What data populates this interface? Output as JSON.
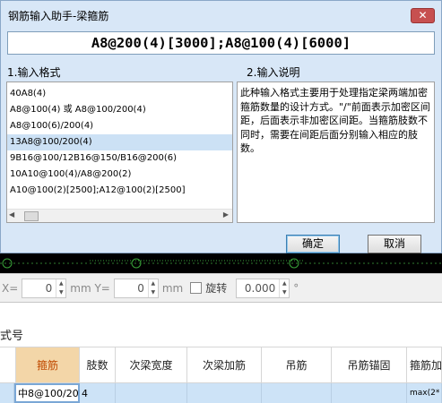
{
  "dialog": {
    "title": "钢筋输入助手-梁箍筋",
    "close_glyph": "✕",
    "input_value": "A8@200(4)[3000];A8@100(4)[6000]",
    "format_label": "1.输入格式",
    "desc_label": "2.输入说明",
    "formats": [
      "40A8(4)",
      "A8@100(4) 或 A8@100/200(4)",
      "A8@100(6)/200(4)",
      "13A8@100/200(4)",
      "9B16@100/12B16@150/B16@200(6)",
      "10A10@100(4)/A8@200(2)",
      "A10@100(2)[2500];A12@100(2)[2500]"
    ],
    "description": "此种输入格式主要用于处理指定梁两端加密箍筋数量的设计方式。\"/\"前面表示加密区间距，后面表示非加密区间距。当箍筋肢数不同时，需要在间距后面分别输入相应的肢数。",
    "ok_label": "确定",
    "cancel_label": "取消"
  },
  "statusbar": {
    "x_label": "X=",
    "x_value": "0",
    "y_label": "mm Y=",
    "y_value": "0",
    "y_unit": "mm",
    "rotate_label": "旋转",
    "rotate_value": "0.000",
    "degree": "°"
  },
  "grid": {
    "section_title": "式号",
    "columns": [
      "",
      "箍筋",
      "肢数",
      "次梁宽度",
      "次梁加筋",
      "吊筋",
      "吊筋锚固",
      "箍筋加"
    ],
    "row": {
      "stirrup": "中8@100/20",
      "legs": "4",
      "tail": "max(2*"
    }
  }
}
